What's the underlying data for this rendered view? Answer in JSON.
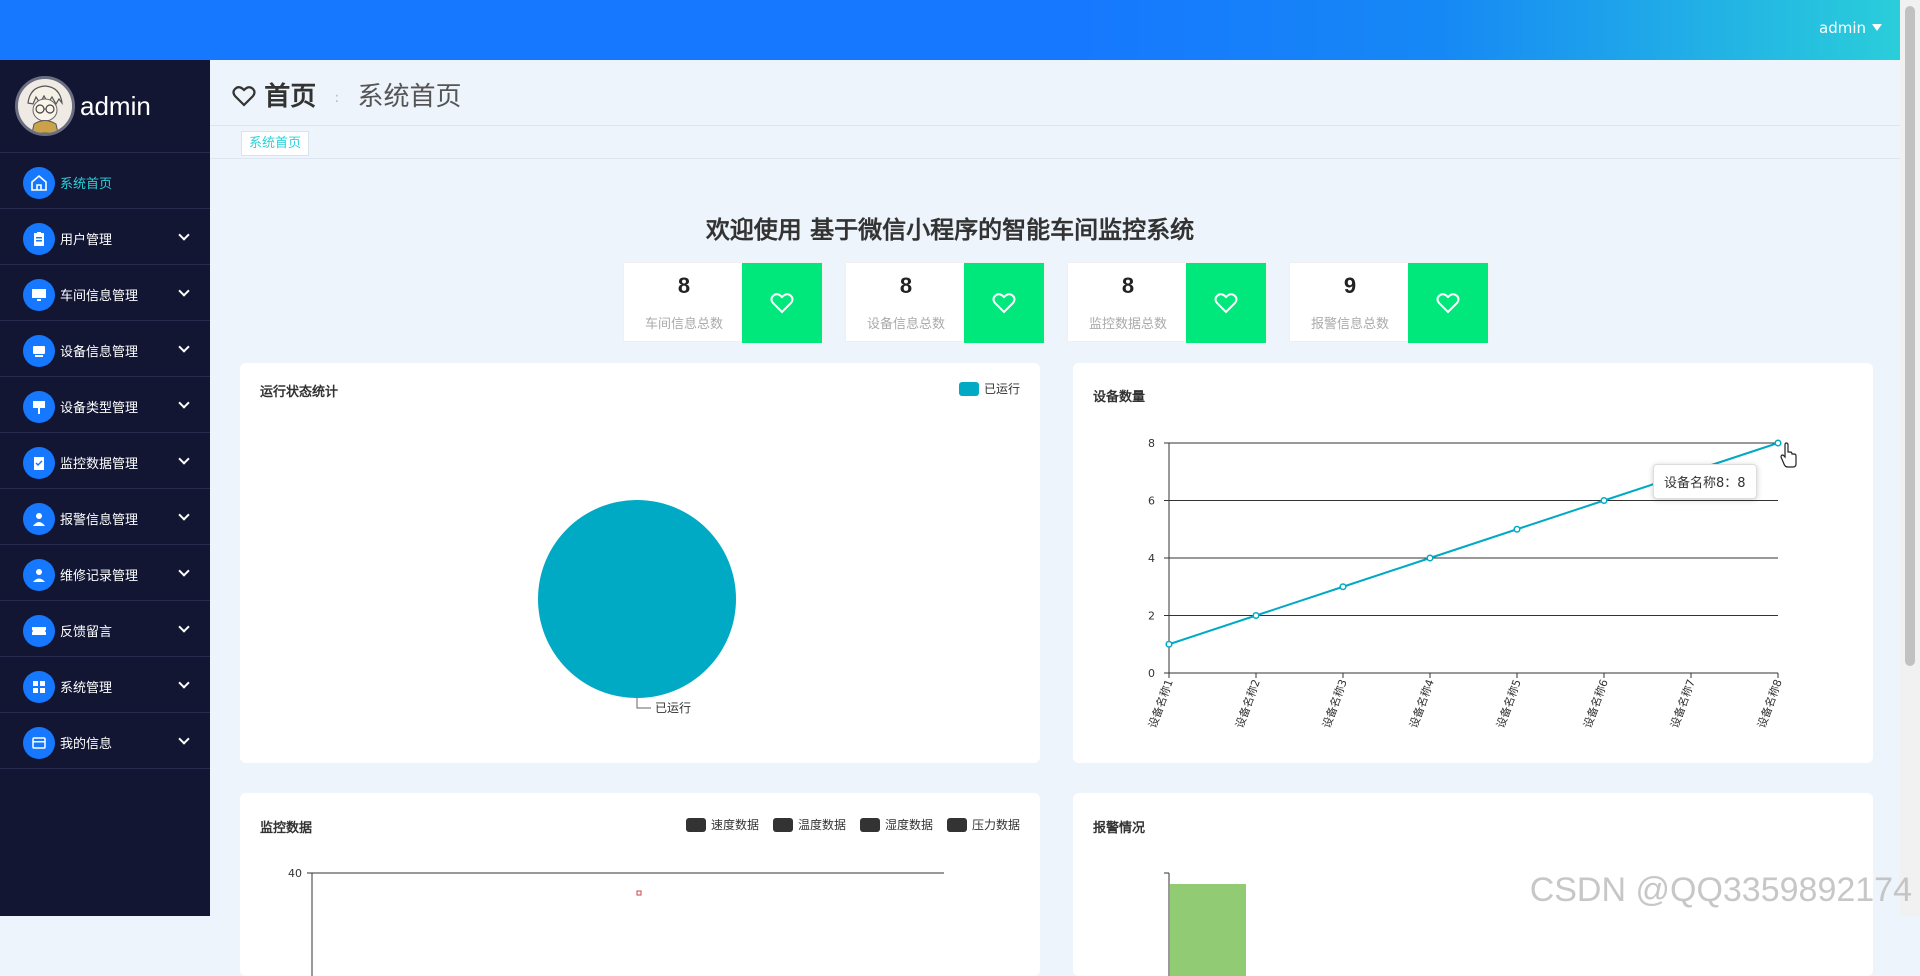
{
  "header": {
    "username": "admin"
  },
  "sidebar": {
    "username": "admin",
    "items": [
      {
        "label": "系统首页",
        "icon": "home-icon",
        "active": true
      },
      {
        "label": "用户管理",
        "icon": "clipboard-icon"
      },
      {
        "label": "车间信息管理",
        "icon": "monitor-icon"
      },
      {
        "label": "设备信息管理",
        "icon": "device-icon"
      },
      {
        "label": "设备类型管理",
        "icon": "sign-icon"
      },
      {
        "label": "监控数据管理",
        "icon": "checklist-icon"
      },
      {
        "label": "报警信息管理",
        "icon": "user-card-icon"
      },
      {
        "label": "维修记录管理",
        "icon": "person-icon"
      },
      {
        "label": "反馈留言",
        "icon": "ticket-icon"
      },
      {
        "label": "系统管理",
        "icon": "grid-icon"
      },
      {
        "label": "我的信息",
        "icon": "wallet-icon"
      }
    ]
  },
  "breadcrumb": {
    "home": "首页",
    "separator": ":",
    "current": "系统首页"
  },
  "tags": {
    "active": "系统首页"
  },
  "welcome": "欢迎使用 基于微信小程序的智能车间监控系统",
  "stats": [
    {
      "value": "8",
      "label": "车间信息总数"
    },
    {
      "value": "8",
      "label": "设备信息总数"
    },
    {
      "value": "8",
      "label": "监控数据总数"
    },
    {
      "value": "9",
      "label": "报警信息总数"
    }
  ],
  "colors": {
    "primary": "#1677ff",
    "accent": "#00e87c",
    "teal": "#00a9c4",
    "sidebar": "#121633",
    "tag_text": "#2bd1d9"
  },
  "chart_data": [
    {
      "type": "pie",
      "title": "运行状态统计",
      "legend": [
        "已运行"
      ],
      "legend_position": "top-right",
      "slices": [
        {
          "name": "已运行",
          "value": 1,
          "color": "#00a9c4"
        }
      ]
    },
    {
      "type": "line",
      "title": "设备数量",
      "categories": [
        "设备名称1",
        "设备名称2",
        "设备名称3",
        "设备名称4",
        "设备名称5",
        "设备名称6",
        "设备名称7",
        "设备名称8"
      ],
      "values": [
        1,
        2,
        3,
        4,
        5,
        6,
        7,
        8
      ],
      "ylim": [
        0,
        8
      ],
      "yticks": [
        0,
        2,
        4,
        6,
        8
      ],
      "grid": true,
      "color": "#00a9c4",
      "tooltip": "设备名称8：8"
    },
    {
      "type": "scatter",
      "title": "监控数据",
      "legend": [
        "速度数据",
        "温度数据",
        "湿度数据",
        "压力数据"
      ],
      "legend_position": "top-right",
      "yticks": [
        40
      ]
    },
    {
      "type": "bar",
      "title": "报警情况",
      "color": "#91cc75"
    }
  ],
  "watermark": "CSDN @QQ3359892174"
}
